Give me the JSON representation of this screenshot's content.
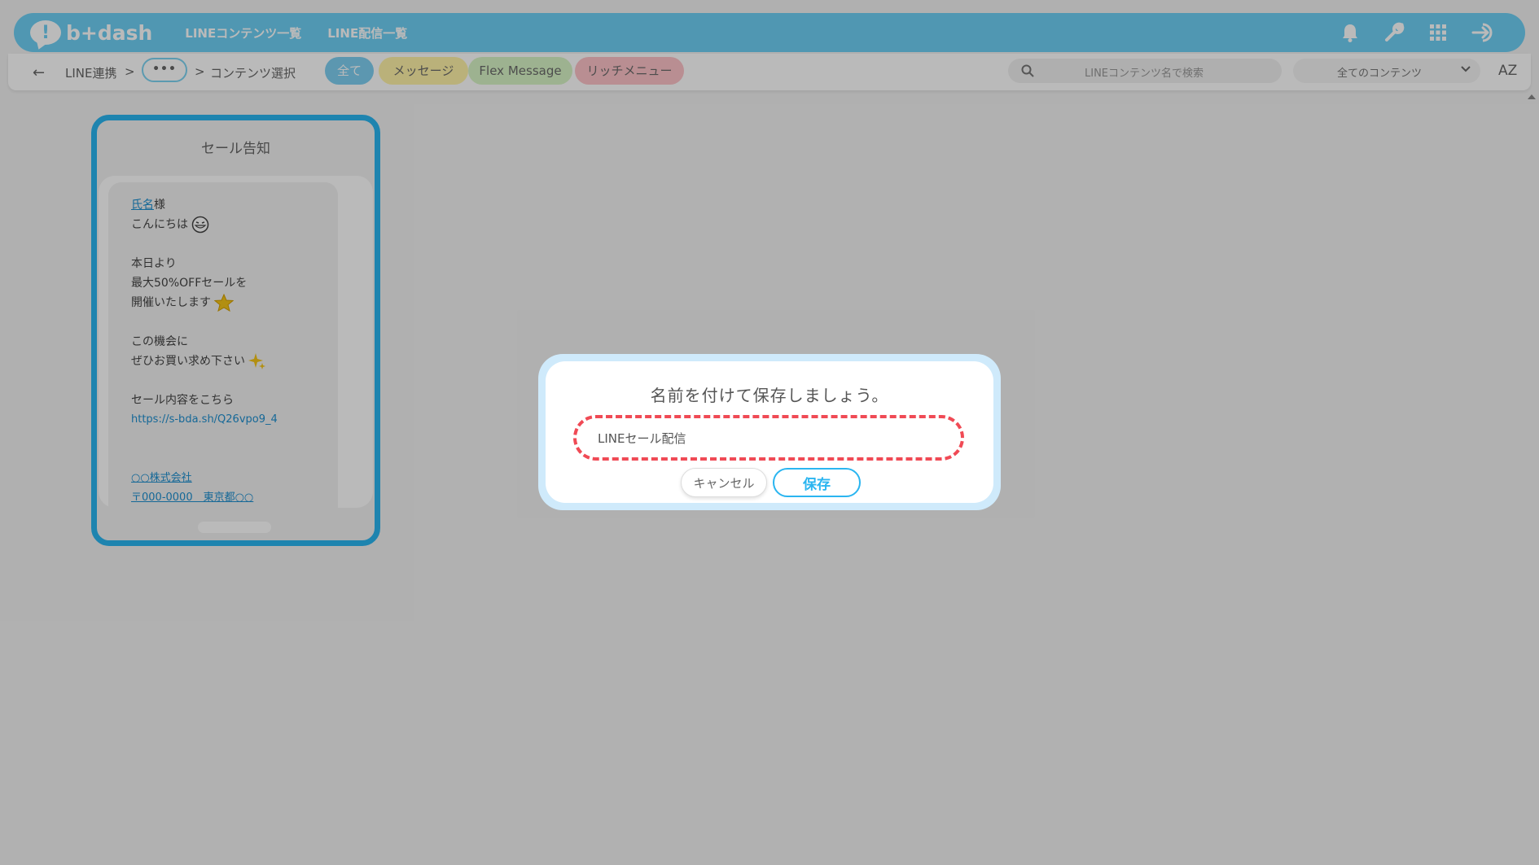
{
  "colors": {
    "brand": "#6ed0f5",
    "accent": "#2ab5f0",
    "highlight": "#f04a55"
  },
  "header": {
    "logo_text": "b+dash",
    "nav": [
      "LINEコンテンツ一覧",
      "LINE配信一覧"
    ],
    "icons": [
      "bell-icon",
      "wrench-icon",
      "grid-icon",
      "logout-icon"
    ]
  },
  "breadcrumb": {
    "root": "LINE連携",
    "sep1": ">",
    "ellipsis": "•••",
    "sep2": ">",
    "current": "コンテンツ選択"
  },
  "filters": {
    "tabs": [
      {
        "label": "全て",
        "active": true
      },
      {
        "label": "メッセージ"
      },
      {
        "label": "Flex Message"
      },
      {
        "label": "リッチメニュー"
      }
    ]
  },
  "search": {
    "placeholder": "LINEコンテンツ名で検索"
  },
  "content_select": {
    "value": "全てのコンテンツ"
  },
  "sort": {
    "label": "AZ"
  },
  "card": {
    "title": "セール告知",
    "message": {
      "name_link": "氏名",
      "name_suffix": "様",
      "greeting": "こんにちは",
      "line3": "本日より",
      "line4": "最大50%OFFセールを",
      "line5": "開催いたします",
      "line6": "この機会に",
      "line7": "ぜひお買い求め下さい",
      "line8": "セール内容をこちら",
      "url": "https://s-bda.sh/Q26vpo9_4",
      "company": "○○株式会社",
      "address": "〒000-0000　東京都○○"
    }
  },
  "dialog": {
    "title": "名前を付けて保存しましょう。",
    "input_value": "LINEセール配信",
    "cancel_label": "キャンセル",
    "save_label": "保存"
  }
}
